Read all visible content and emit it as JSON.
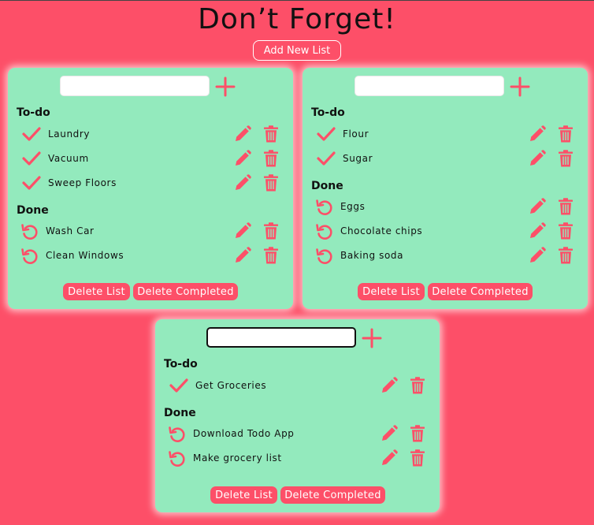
{
  "app": {
    "title": "Don’t Forget!",
    "add_list_label": "Add New List"
  },
  "colors": {
    "background": "#fd4f68",
    "card": "#93eabd",
    "accent": "#fd4f68",
    "text": "#111111"
  },
  "icons": {
    "add": "plus-icon",
    "todo": "checkmark-icon",
    "done": "undo-icon",
    "edit": "pencil-icon",
    "delete": "trash-icon"
  },
  "labels": {
    "todo_heading": "To-do",
    "done_heading": "Done",
    "delete_list": "Delete List",
    "delete_completed": "Delete Completed"
  },
  "lists": [
    {
      "input_value": "",
      "focused": false,
      "todo": [
        "Laundry",
        "Vacuum",
        "Sweep Floors"
      ],
      "done": [
        "Wash Car",
        "Clean Windows"
      ]
    },
    {
      "input_value": "",
      "focused": false,
      "todo": [
        "Flour",
        "Sugar"
      ],
      "done": [
        "Eggs",
        "Chocolate chips",
        "Baking soda"
      ]
    },
    {
      "input_value": "",
      "focused": true,
      "todo": [
        "Get Groceries"
      ],
      "done": [
        "Download Todo App",
        "Make grocery list"
      ]
    }
  ]
}
